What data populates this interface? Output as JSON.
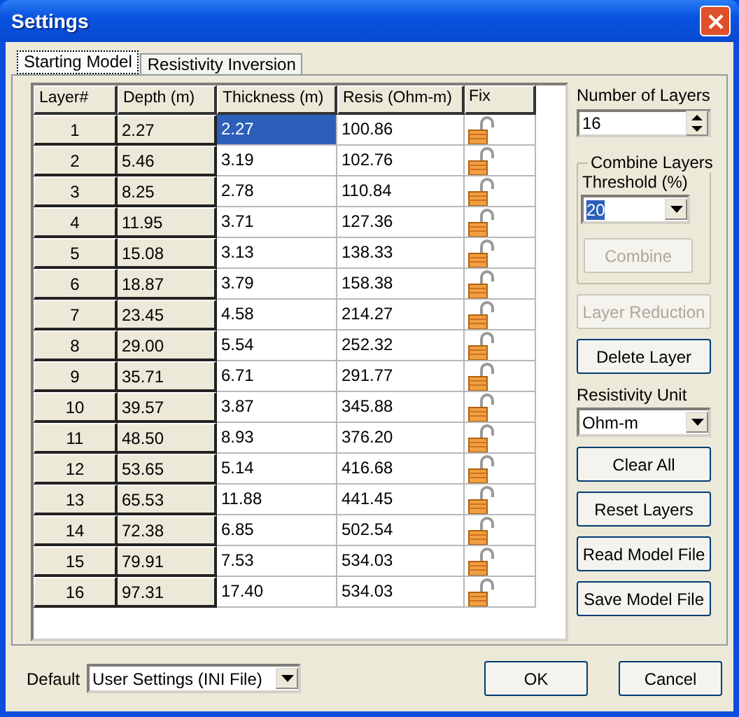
{
  "window": {
    "title": "Settings"
  },
  "tabs": [
    {
      "label": "Starting Model",
      "selected": true
    },
    {
      "label": "Resistivity Inversion",
      "selected": false
    }
  ],
  "table": {
    "columns": [
      "Layer#",
      "Depth (m)",
      "Thickness (m)",
      "Resis (Ohm-m)",
      "Fix"
    ],
    "rows": [
      {
        "layer": "1",
        "depth": "2.27",
        "thickness": "2.27",
        "resis": "100.86",
        "fixed": false,
        "selected": true
      },
      {
        "layer": "2",
        "depth": "5.46",
        "thickness": "3.19",
        "resis": "102.76",
        "fixed": false,
        "selected": false
      },
      {
        "layer": "3",
        "depth": "8.25",
        "thickness": "2.78",
        "resis": "110.84",
        "fixed": false,
        "selected": false
      },
      {
        "layer": "4",
        "depth": "11.95",
        "thickness": "3.71",
        "resis": "127.36",
        "fixed": false,
        "selected": false
      },
      {
        "layer": "5",
        "depth": "15.08",
        "thickness": "3.13",
        "resis": "138.33",
        "fixed": false,
        "selected": false
      },
      {
        "layer": "6",
        "depth": "18.87",
        "thickness": "3.79",
        "resis": "158.38",
        "fixed": false,
        "selected": false
      },
      {
        "layer": "7",
        "depth": "23.45",
        "thickness": "4.58",
        "resis": "214.27",
        "fixed": false,
        "selected": false
      },
      {
        "layer": "8",
        "depth": "29.00",
        "thickness": "5.54",
        "resis": "252.32",
        "fixed": false,
        "selected": false
      },
      {
        "layer": "9",
        "depth": "35.71",
        "thickness": "6.71",
        "resis": "291.77",
        "fixed": false,
        "selected": false
      },
      {
        "layer": "10",
        "depth": "39.57",
        "thickness": "3.87",
        "resis": "345.88",
        "fixed": false,
        "selected": false
      },
      {
        "layer": "11",
        "depth": "48.50",
        "thickness": "8.93",
        "resis": "376.20",
        "fixed": false,
        "selected": false
      },
      {
        "layer": "12",
        "depth": "53.65",
        "thickness": "5.14",
        "resis": "416.68",
        "fixed": false,
        "selected": false
      },
      {
        "layer": "13",
        "depth": "65.53",
        "thickness": "11.88",
        "resis": "441.45",
        "fixed": false,
        "selected": false
      },
      {
        "layer": "14",
        "depth": "72.38",
        "thickness": "6.85",
        "resis": "502.54",
        "fixed": false,
        "selected": false
      },
      {
        "layer": "15",
        "depth": "79.91",
        "thickness": "7.53",
        "resis": "534.03",
        "fixed": false,
        "selected": false
      },
      {
        "layer": "16",
        "depth": "97.31",
        "thickness": "17.40",
        "resis": "534.03",
        "fixed": false,
        "selected": false
      }
    ]
  },
  "number_of_layers": {
    "label": "Number of Layers",
    "value": "16"
  },
  "combine_layers": {
    "title": "Combine Layers",
    "threshold_label": "Threshold (%)",
    "threshold_value": "20",
    "button": {
      "label": "Combine",
      "disabled": true
    }
  },
  "buttons_top": [
    {
      "label": "Layer Reduction",
      "disabled": true
    },
    {
      "label": "Delete Layer",
      "disabled": false
    }
  ],
  "resistivity_unit": {
    "label": "Resistivity Unit",
    "value": "Ohm-m"
  },
  "buttons_bottom": [
    {
      "label": "Clear All",
      "disabled": false
    },
    {
      "label": "Reset Layers",
      "disabled": false
    },
    {
      "label": "Read Model File",
      "disabled": false
    },
    {
      "label": "Save Model File",
      "disabled": false
    }
  ],
  "footer": {
    "default_label": "Default",
    "default_value": "User Settings (INI File)",
    "ok": "OK",
    "cancel": "Cancel"
  }
}
